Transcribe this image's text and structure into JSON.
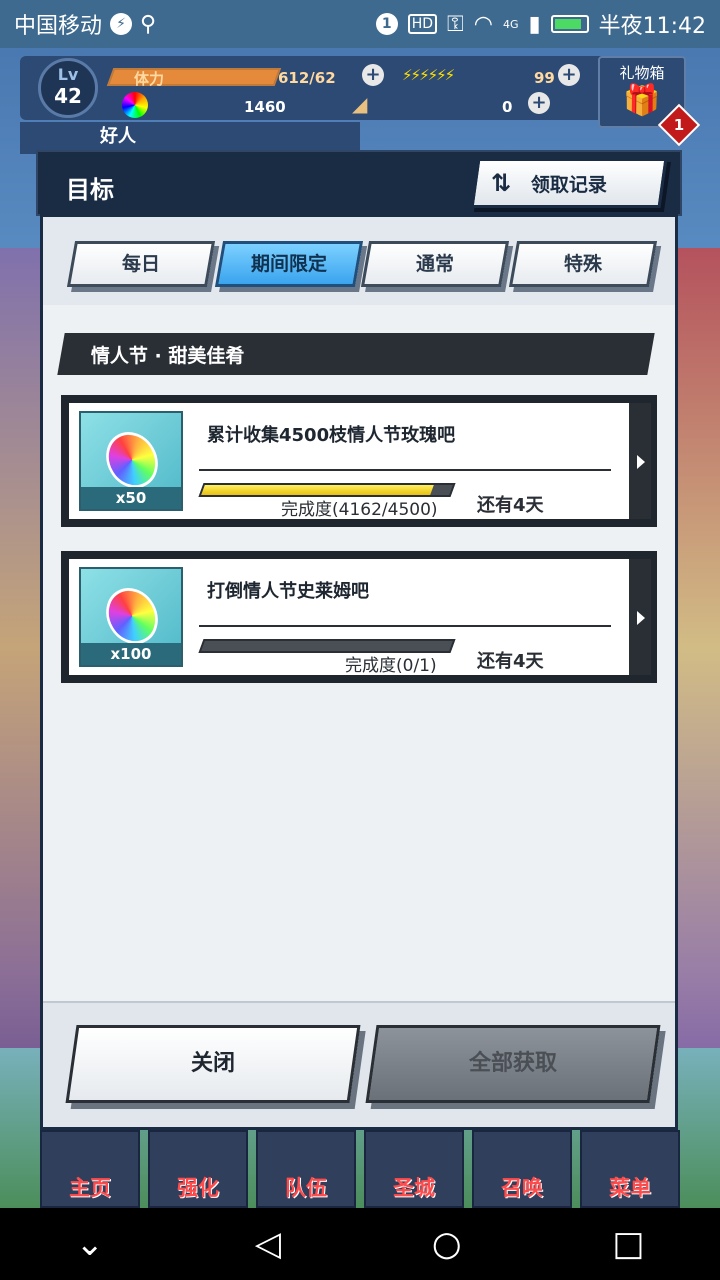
{
  "status_bar": {
    "carrier": "中国移动",
    "net": "4G",
    "time": "半夜11:42"
  },
  "game_header": {
    "level_label": "Lv",
    "level": "42",
    "stamina_label": "体力",
    "stamina": "612/62",
    "bolts": "99",
    "gems": "1460",
    "tickets": "0",
    "gift_label": "礼物箱",
    "gift_badge": "1",
    "friend_label": "好人"
  },
  "dialog": {
    "title": "目标",
    "record_button": "领取记录",
    "tabs": [
      "每日",
      "期间限定",
      "通常",
      "特殊"
    ],
    "active_tab": 1,
    "section_title": "情人节 · 甜美佳肴",
    "missions": [
      {
        "title": "累计收集4500枝情人节玫瑰吧",
        "reward_qty": "x50",
        "progress_text": "完成度(4162/4500)",
        "progress_fraction": 0.925,
        "remaining": "还有4天"
      },
      {
        "title": "打倒情人节史莱姆吧",
        "reward_qty": "x100",
        "progress_text": "完成度(0/1)",
        "progress_fraction": 0,
        "remaining": "还有4天"
      }
    ],
    "close_button": "关闭",
    "claim_all_button": "全部获取"
  },
  "bottom_nav": [
    "主页",
    "强化",
    "队伍",
    "圣城",
    "召唤",
    "菜单"
  ],
  "system_nav": {
    "down": "⌄",
    "back": "◁",
    "home": "○",
    "recent": "□"
  }
}
